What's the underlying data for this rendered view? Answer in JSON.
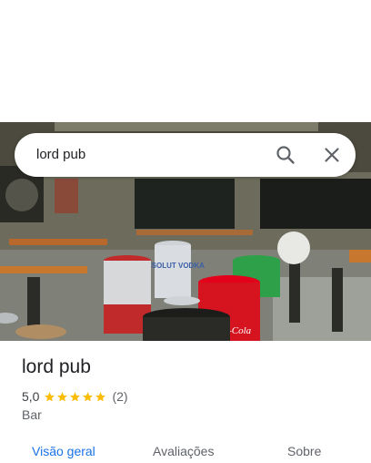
{
  "search": {
    "query": "lord pub",
    "search_icon": "search-icon",
    "close_icon": "close-icon"
  },
  "place": {
    "name": "lord pub",
    "rating": "5,0",
    "stars": 5,
    "review_count": "(2)",
    "category": "Bar"
  },
  "photo": {
    "sign_text": "ABSOLUT VODKA",
    "cola_text": "Coca-Cola"
  },
  "tabs": [
    {
      "label": "Visão geral",
      "active": true
    },
    {
      "label": "Avaliações",
      "active": false
    },
    {
      "label": "Sobre",
      "active": false
    }
  ],
  "colors": {
    "accent": "#1a73e8",
    "star": "#fbbc04",
    "muted": "#5f6368"
  }
}
